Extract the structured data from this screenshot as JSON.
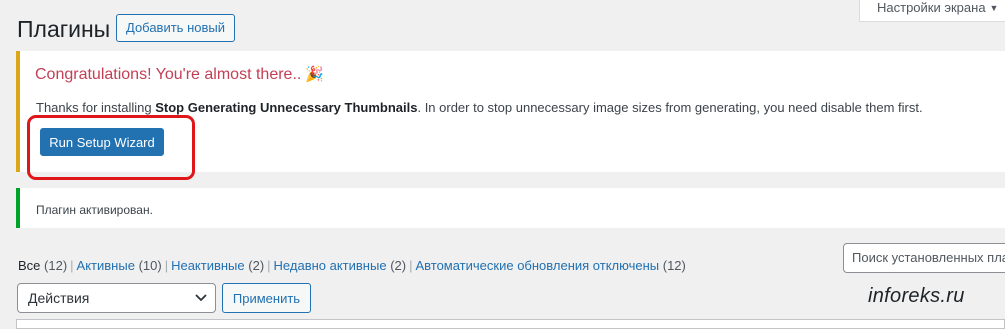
{
  "header": {
    "screen_options_label": "Настройки экрана",
    "title": "Плагины",
    "add_new_label": "Добавить новый"
  },
  "setup_notice": {
    "title": "Congratulations! You're almost there..",
    "title_icon": "party-popper-icon",
    "text_before": "Thanks for installing ",
    "plugin_name": "Stop Generating Unnecessary Thumbnails",
    "text_after": ". In order to stop unnecessary image sizes from generating, you need disable them first.",
    "button_label": "Run Setup Wizard"
  },
  "success_notice": {
    "text": "Плагин активирован."
  },
  "filters": [
    {
      "label": "Все",
      "count": "(12)"
    },
    {
      "label": "Активные",
      "count": "(10)"
    },
    {
      "label": "Неактивные",
      "count": "(2)"
    },
    {
      "label": "Недавно активные",
      "count": "(2)"
    },
    {
      "label": "Автоматические обновления отключены",
      "count": "(12)"
    }
  ],
  "search": {
    "placeholder": "Поиск установленных плагинов"
  },
  "bulk_actions": {
    "selected": "Действия",
    "apply_label": "Применить"
  },
  "watermark": "inforeks.ru",
  "colors": {
    "accent": "#2271b1",
    "warning_border": "#dba617",
    "success_border": "#00a32a",
    "notice_title": "#c33f55",
    "highlight": "#e0171a"
  }
}
